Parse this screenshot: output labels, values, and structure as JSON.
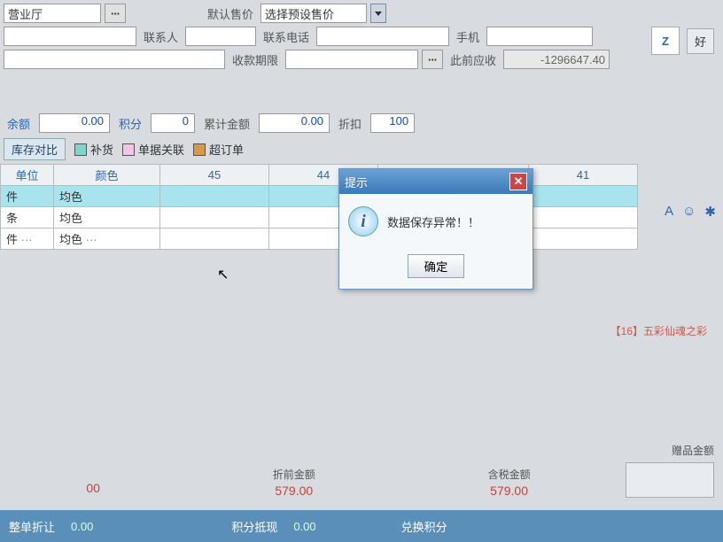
{
  "header": {
    "dept_value": "营业厅",
    "default_price_label": "默认售价",
    "default_price_value": "选择预设售价"
  },
  "contact": {
    "contact_label": "联系人",
    "phone_label": "联系电话",
    "mobile_label": "手机"
  },
  "payment": {
    "due_label": "收款期限",
    "prior_label": "此前应收",
    "prior_value": "-1296647.40"
  },
  "mid": {
    "balance_label": "余额",
    "balance_value": "0.00",
    "points_label": "积分",
    "points_value": "0",
    "acc_label": "累计金额",
    "acc_value": "0.00",
    "discount_label": "折扣",
    "discount_value": "100"
  },
  "legend": {
    "compare_btn": "库存对比",
    "item1": "补货",
    "item2": "单据关联",
    "item3": "超订单"
  },
  "table": {
    "cols": [
      "单位",
      "颜色",
      "45",
      "44",
      "41"
    ],
    "rows": [
      {
        "unit": "件",
        "color": "均色"
      },
      {
        "unit": "条",
        "color": "均色"
      },
      {
        "unit": "件",
        "color": "均色"
      }
    ]
  },
  "dialog": {
    "title": "提示",
    "message": "数据保存异常！！",
    "ok": "确定"
  },
  "bottom_link": "【16】五彩仙魂之彩",
  "totals": {
    "left_val": "00",
    "pre_discount_label": "折前金额",
    "pre_discount_val": "579.00",
    "taxed_label": "含税金额",
    "taxed_val": "579.00",
    "gift_label": "赠品金额"
  },
  "bottombar": {
    "l1": "整单折让",
    "v1": "0.00",
    "l2": "积分抵现",
    "v2": "0.00",
    "l3": "兑换积分"
  },
  "side_btn": "好"
}
